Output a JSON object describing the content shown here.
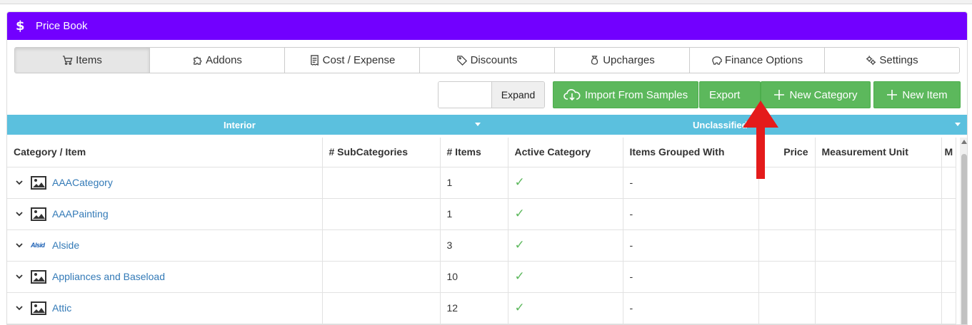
{
  "header": {
    "icon": "dollar-icon",
    "title": "Price Book",
    "color": "#7200ff"
  },
  "tabs": [
    {
      "label": "Items",
      "icon": "cart-icon",
      "active": true
    },
    {
      "label": "Addons",
      "icon": "puzzle-icon"
    },
    {
      "label": "Cost / Expense",
      "icon": "receipt-icon"
    },
    {
      "label": "Discounts",
      "icon": "tag-icon"
    },
    {
      "label": "Upcharges",
      "icon": "money-bag-icon"
    },
    {
      "label": "Finance Options",
      "icon": "piggy-bank-icon"
    },
    {
      "label": "Settings",
      "icon": "gears-icon"
    }
  ],
  "toolbar": {
    "expand_label": "Expand",
    "import_label": "Import From Samples",
    "export_label": "Export",
    "new_category_label": "New Category",
    "new_item_label": "New Item"
  },
  "category_bar": {
    "left": "Interior",
    "right": "Unclassified",
    "color": "#5bc0de"
  },
  "table": {
    "columns": [
      "Category / Item",
      "# SubCategories",
      "# Items",
      "Active Category",
      "Items Grouped With",
      "Price",
      "Measurement Unit",
      "M"
    ],
    "rows": [
      {
        "name": "AAACategory",
        "icon": "image-icon",
        "subcategories": "",
        "items": "1",
        "active": true,
        "grouped_with": "-",
        "price": "",
        "unit": ""
      },
      {
        "name": "AAAPainting",
        "icon": "image-icon",
        "subcategories": "",
        "items": "1",
        "active": true,
        "grouped_with": "-",
        "price": "",
        "unit": ""
      },
      {
        "name": "Alside",
        "icon": "alside-logo",
        "logo_text": "Alside",
        "subcategories": "",
        "items": "3",
        "active": true,
        "grouped_with": "-",
        "price": "",
        "unit": ""
      },
      {
        "name": "Appliances and Baseload",
        "icon": "image-icon",
        "subcategories": "",
        "items": "10",
        "active": true,
        "grouped_with": "-",
        "price": "",
        "unit": ""
      },
      {
        "name": "Attic",
        "icon": "image-icon",
        "subcategories": "",
        "items": "12",
        "active": true,
        "grouped_with": "-",
        "price": "",
        "unit": ""
      }
    ]
  },
  "check_glyph": "✓",
  "annotation": {
    "type": "red-arrow-up",
    "color": "#e41b1b"
  }
}
